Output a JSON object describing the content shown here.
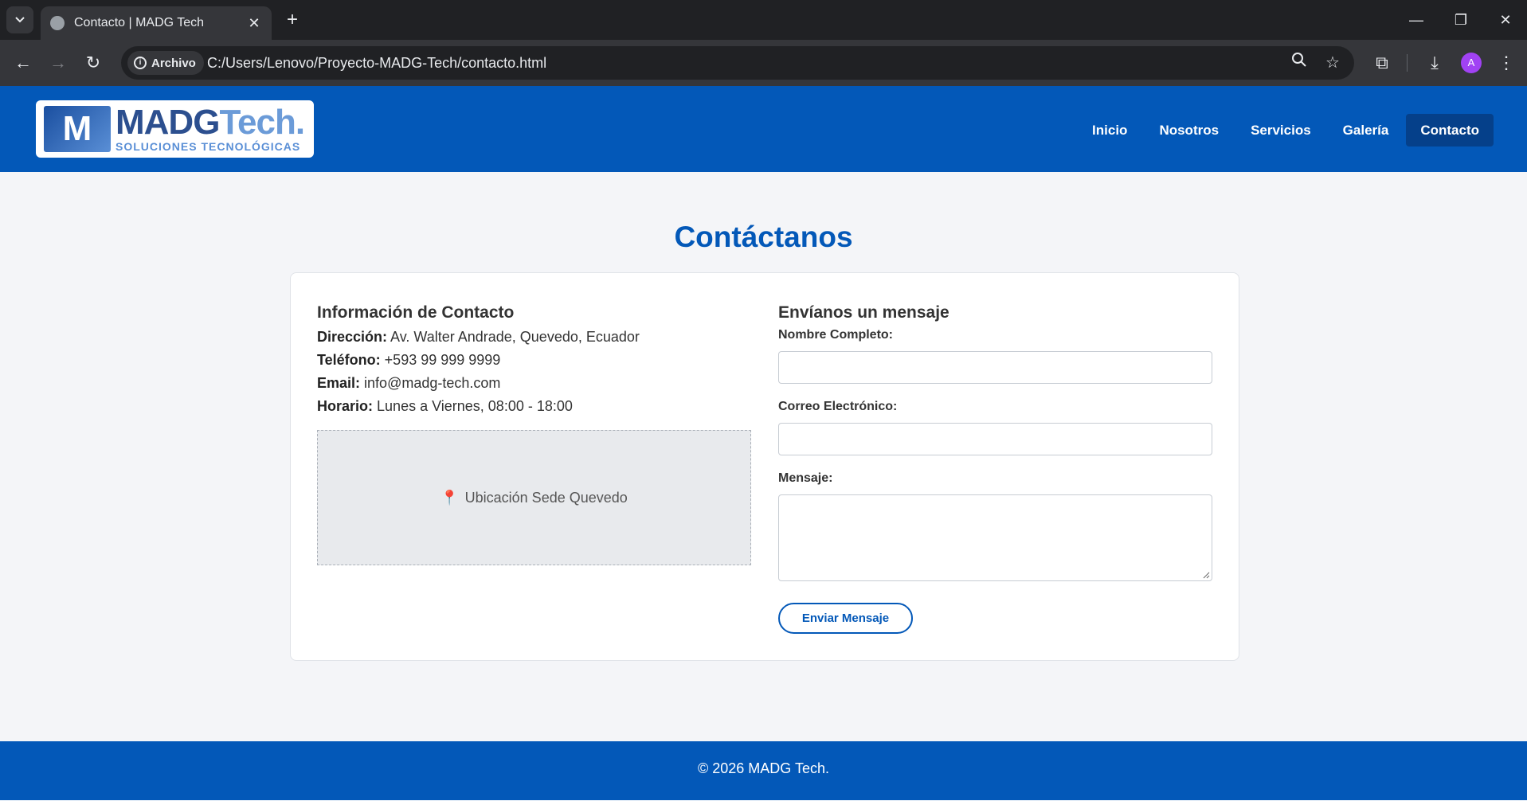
{
  "browser": {
    "tab_title": "Contacto | MADG Tech",
    "chip_label": "Archivo",
    "url": "C:/Users/Lenovo/Proyecto-MADG-Tech/contacto.html",
    "avatar_letter": "A"
  },
  "header": {
    "logo_name_1": "MADG",
    "logo_name_2": "Tech.",
    "logo_sub": "SOLUCIONES TECNOLÓGICAS",
    "nav": [
      {
        "label": "Inicio"
      },
      {
        "label": "Nosotros"
      },
      {
        "label": "Servicios"
      },
      {
        "label": "Galería"
      },
      {
        "label": "Contacto",
        "active": true
      }
    ]
  },
  "main": {
    "title": "Contáctanos",
    "info": {
      "heading": "Información de Contacto",
      "items": [
        {
          "label": "Dirección:",
          "value": "Av. Walter Andrade, Quevedo, Ecuador"
        },
        {
          "label": "Teléfono:",
          "value": "+593 99 999 9999"
        },
        {
          "label": "Email:",
          "value": "info@madg-tech.com"
        },
        {
          "label": "Horario:",
          "value": "Lunes a Viernes, 08:00 - 18:00"
        }
      ],
      "map_label": "Ubicación Sede Quevedo"
    },
    "form": {
      "heading": "Envíanos un mensaje",
      "name_label": "Nombre Completo:",
      "email_label": "Correo Electrónico:",
      "message_label": "Mensaje:",
      "submit_label": "Enviar Mensaje"
    }
  },
  "footer": {
    "text": "© 2026 MADG Tech."
  },
  "colors": {
    "brand_blue": "#0358b8",
    "nav_active": "#05408a"
  }
}
